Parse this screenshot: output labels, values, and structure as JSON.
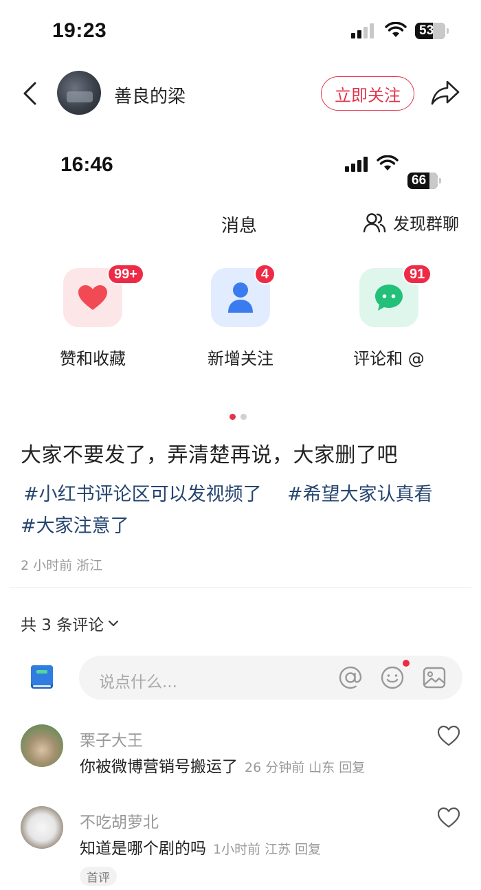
{
  "status_bar": {
    "time": "19:23",
    "battery": "53"
  },
  "header": {
    "author_name": "善良的梁",
    "follow_label": "立即关注"
  },
  "embedded_screen": {
    "time": "16:46",
    "battery": "66",
    "title": "消息",
    "group_chat_label": "发现群聊",
    "tiles": [
      {
        "label": "赞和收藏",
        "badge": "99+",
        "icon": "heart-icon"
      },
      {
        "label": "新增关注",
        "badge": "4",
        "icon": "person-icon"
      },
      {
        "label": "评论和 @",
        "badge": "91",
        "icon": "chat-bubble-icon"
      }
    ]
  },
  "carousel": {
    "active_color": "#e3344a",
    "inactive_color": "#d0d0d0"
  },
  "post": {
    "title": "大家不要发了，弄清楚再说，大家删了吧",
    "tags": [
      "#小红书评论区可以发视频了",
      "#希望大家认真看",
      "#大家注意了"
    ],
    "meta": "2 小时前 浙江"
  },
  "comments_section": {
    "count_label": "共 3 条评论",
    "input_placeholder": "说点什么...",
    "items": [
      {
        "name": "栗子大王",
        "text": "你被微博营销号搬运了",
        "meta": "26 分钟前 山东 回复"
      },
      {
        "name": "不吃胡萝北",
        "text": "知道是哪个剧的吗",
        "meta": "1小时前 江苏 回复",
        "tag": "首评"
      }
    ]
  },
  "colors": {
    "accent": "#e3344a",
    "tag_blue": "#25456f"
  }
}
